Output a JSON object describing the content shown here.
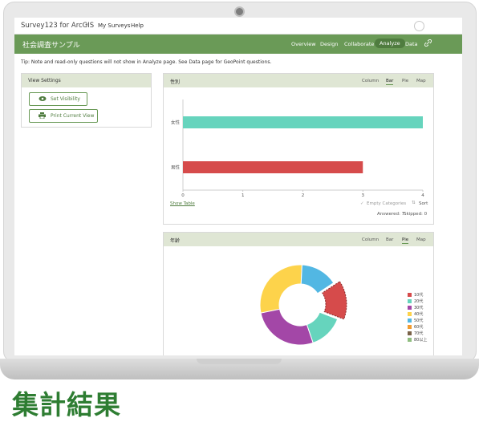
{
  "topnav": {
    "brand": "Survey123 for ArcGIS",
    "caret": "▾",
    "links": [
      "My Surveys",
      "Help"
    ]
  },
  "header": {
    "survey_title": "社会調査サンプル",
    "tabs": [
      "Overview",
      "Design",
      "Collaborate",
      "Analyze",
      "Data"
    ],
    "active_tab": "Analyze",
    "link_icon": "link-icon"
  },
  "tip": "Tip: Note and read-only questions will not show in Analyze page. See Data page for GeoPoint questions.",
  "view_settings": {
    "title": "View Settings",
    "buttons": [
      {
        "label": "Set Visibility",
        "icon": "eye-icon"
      },
      {
        "label": "Print Current View",
        "icon": "printer-icon"
      }
    ]
  },
  "view_tabs": [
    "Column",
    "Bar",
    "Pie",
    "Map"
  ],
  "gender_card": {
    "title": "性別",
    "active_tab": "Bar",
    "show_table": "Show Table",
    "empty_categories": "Empty Categories",
    "sort": "Sort",
    "answered": "Answered: 7",
    "skipped": "Skipped: 0"
  },
  "age_card": {
    "title": "年齢",
    "active_tab": "Pie"
  },
  "chart_data": [
    {
      "type": "bar",
      "orientation": "horizontal",
      "categories": [
        "女性",
        "男性"
      ],
      "values": [
        4,
        3
      ],
      "colors": [
        "#66d4bd",
        "#d64b4b"
      ],
      "xlim": [
        0,
        4
      ],
      "xticks": [
        "0",
        "1",
        "2",
        "3",
        "4"
      ]
    },
    {
      "type": "pie",
      "donut": true,
      "categories": [
        "10代",
        "20代",
        "30代",
        "40代",
        "50代",
        "60代",
        "70代",
        "80以上"
      ],
      "values": [
        15,
        14,
        27,
        29,
        15,
        0,
        0,
        0
      ],
      "colors": [
        "#d64b4b",
        "#66d4bd",
        "#a347a7",
        "#fdd34b",
        "#52b7e3",
        "#f39c31",
        "#7a6248",
        "#8fbd7f"
      ],
      "highlighted": "10代"
    }
  ],
  "footer_title": "集計結果"
}
